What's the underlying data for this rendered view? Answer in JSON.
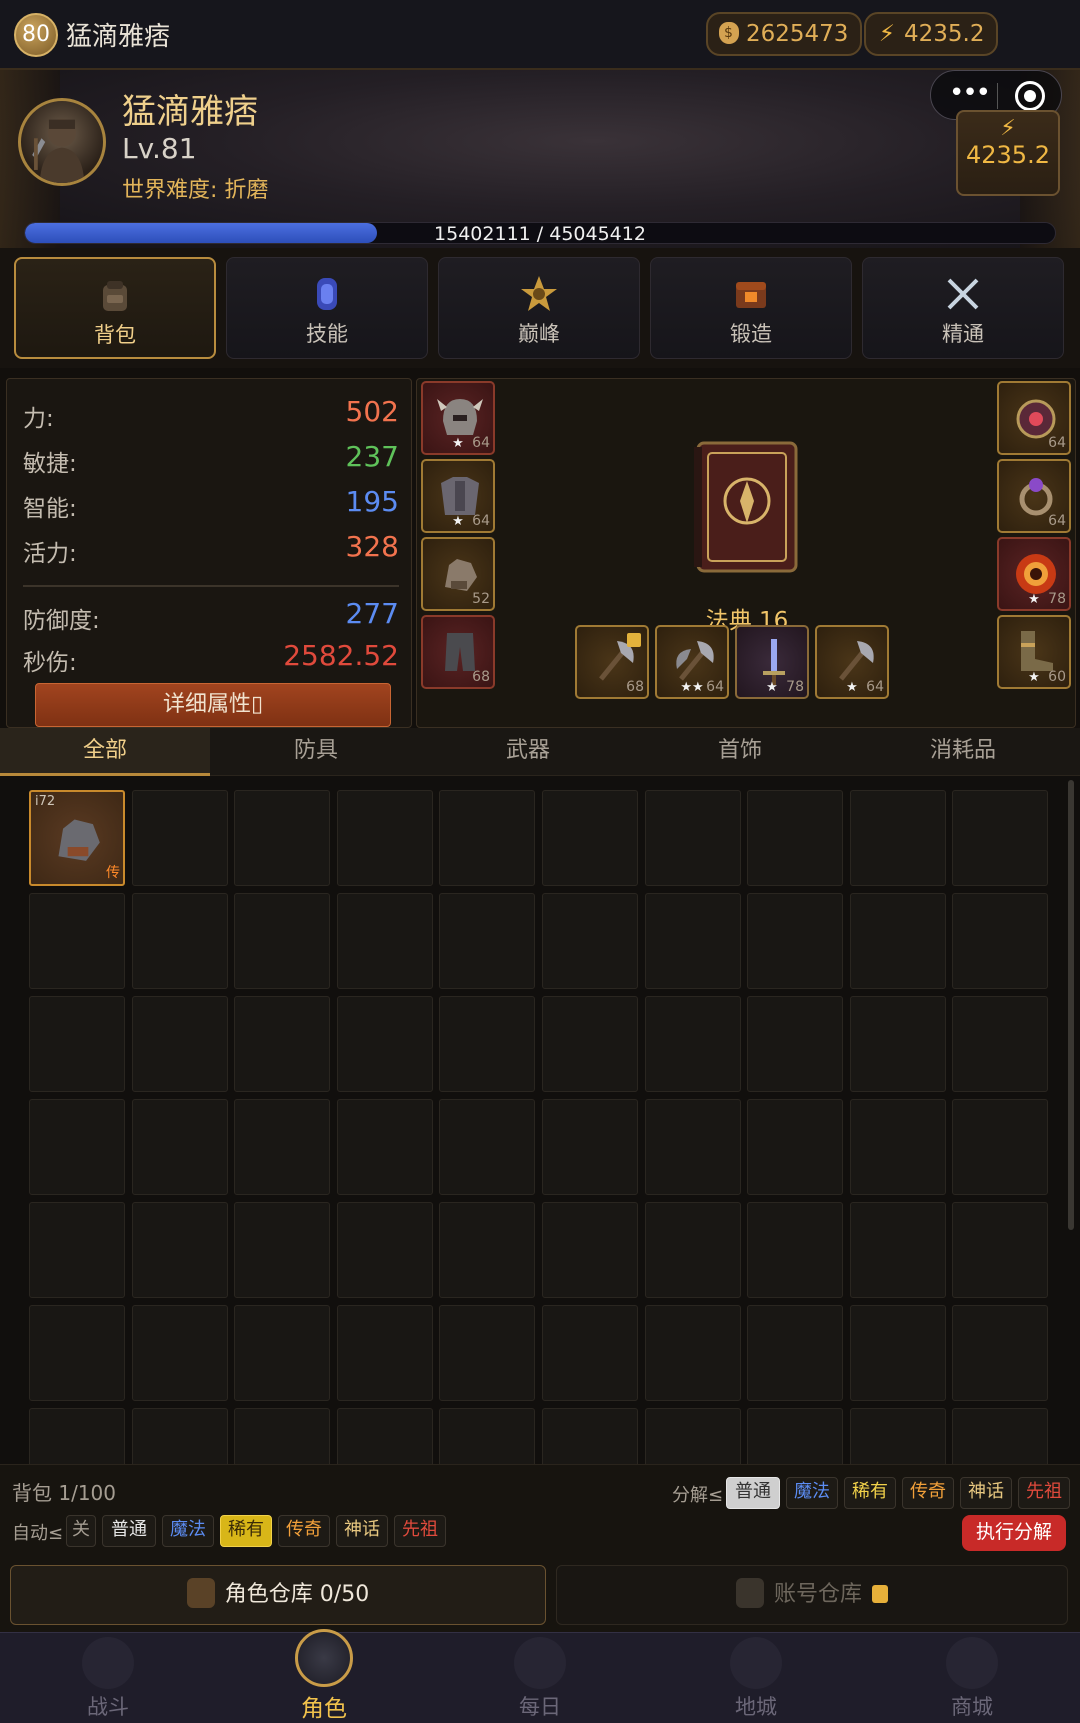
{
  "topbar": {
    "level": "80",
    "name": "猛滴雅痞",
    "gold": "2625473",
    "power": "4235.2"
  },
  "header": {
    "name": "猛滴雅痞",
    "level_text": "Lv.81",
    "difficulty": "世界难度: 折磨",
    "power": "4235.2",
    "xp_text": "15402111 / 45045412",
    "xp_current": 15402111,
    "xp_max": 45045412
  },
  "main_tabs": [
    {
      "label": "背包",
      "active": true
    },
    {
      "label": "技能",
      "active": false
    },
    {
      "label": "巅峰",
      "active": false
    },
    {
      "label": "锻造",
      "active": false
    },
    {
      "label": "精通",
      "active": false
    }
  ],
  "stats": {
    "str": {
      "label": "力:",
      "value": "502",
      "color": "#f2734e"
    },
    "dex": {
      "label": "敏捷:",
      "value": "237",
      "color": "#5fc25a"
    },
    "int": {
      "label": "智能:",
      "value": "195",
      "color": "#5c8cf2"
    },
    "vit": {
      "label": "活力:",
      "value": "328",
      "color": "#f2734e"
    },
    "def": {
      "label": "防御度:",
      "value": "277",
      "color": "#5c8cf2"
    },
    "dps": {
      "label": "秒伤:",
      "value": "2582.52",
      "color": "#e04a3c"
    },
    "detail_button": "详细属性▯"
  },
  "equipment": {
    "left": [
      {
        "icon": "helmet-icon",
        "stars": "★",
        "num": "64"
      },
      {
        "icon": "chest-armor-icon",
        "stars": "★",
        "num": "64"
      },
      {
        "icon": "gauntlet-icon",
        "stars": "",
        "num": "52"
      },
      {
        "icon": "pants-icon",
        "stars": "",
        "num": "68"
      }
    ],
    "right": [
      {
        "icon": "amulet-icon",
        "stars": "",
        "num": "64"
      },
      {
        "icon": "ring-icon",
        "stars": "",
        "num": "64"
      },
      {
        "icon": "fire-ring-icon",
        "stars": "★",
        "num": "78"
      },
      {
        "icon": "boots-icon",
        "stars": "★",
        "num": "60"
      }
    ],
    "weapons": [
      {
        "icon": "axe-icon",
        "stars": "",
        "num": "68",
        "locked": true
      },
      {
        "icon": "axe-icon",
        "stars": "★★",
        "num": "64",
        "locked": false
      },
      {
        "icon": "sword-icon",
        "stars": "★",
        "num": "78",
        "locked": false
      },
      {
        "icon": "axe-icon",
        "stars": "★",
        "num": "64",
        "locked": false
      }
    ],
    "codex_label": "法典 16"
  },
  "category_tabs": [
    {
      "label": "全部",
      "active": true
    },
    {
      "label": "防具",
      "active": false
    },
    {
      "label": "武器",
      "active": false
    },
    {
      "label": "首饰",
      "active": false
    },
    {
      "label": "消耗品",
      "active": false
    }
  ],
  "inventory": {
    "first_item": {
      "ilvl": "i72",
      "rarity": "传",
      "icon": "gauntlet-icon"
    },
    "bag_count": "背包 1/100"
  },
  "salvage": {
    "label": "分解≤",
    "options": [
      {
        "label": "普通",
        "color": "#e6e6e6",
        "selected": true
      },
      {
        "label": "魔法",
        "color": "#5c8cf2",
        "selected": false
      },
      {
        "label": "稀有",
        "color": "#f2d24a",
        "selected": false
      },
      {
        "label": "传奇",
        "color": "#f2a03a",
        "selected": false
      },
      {
        "label": "神话",
        "color": "#e8c880",
        "selected": false
      },
      {
        "label": "先祖",
        "color": "#e04a3c",
        "selected": false
      }
    ],
    "auto_label": "自动≤",
    "auto_options": [
      {
        "label": "关",
        "color": "#a59d92",
        "selected": false
      },
      {
        "label": "普通",
        "color": "#e6e6e6",
        "selected": false
      },
      {
        "label": "魔法",
        "color": "#5c8cf2",
        "selected": false
      },
      {
        "label": "稀有",
        "color": "#f2d24a",
        "selected": true
      },
      {
        "label": "传奇",
        "color": "#f2a03a",
        "selected": false
      },
      {
        "label": "神话",
        "color": "#e8c880",
        "selected": false
      },
      {
        "label": "先祖",
        "color": "#e04a3c",
        "selected": false
      }
    ],
    "execute": "执行分解"
  },
  "stash": {
    "role": "角色仓库 0/50",
    "account": "账号仓库"
  },
  "bottom_nav": [
    {
      "label": "战斗",
      "active": false
    },
    {
      "label": "角色",
      "active": true
    },
    {
      "label": "每日",
      "active": false
    },
    {
      "label": "地城",
      "active": false
    },
    {
      "label": "商城",
      "active": false
    }
  ]
}
